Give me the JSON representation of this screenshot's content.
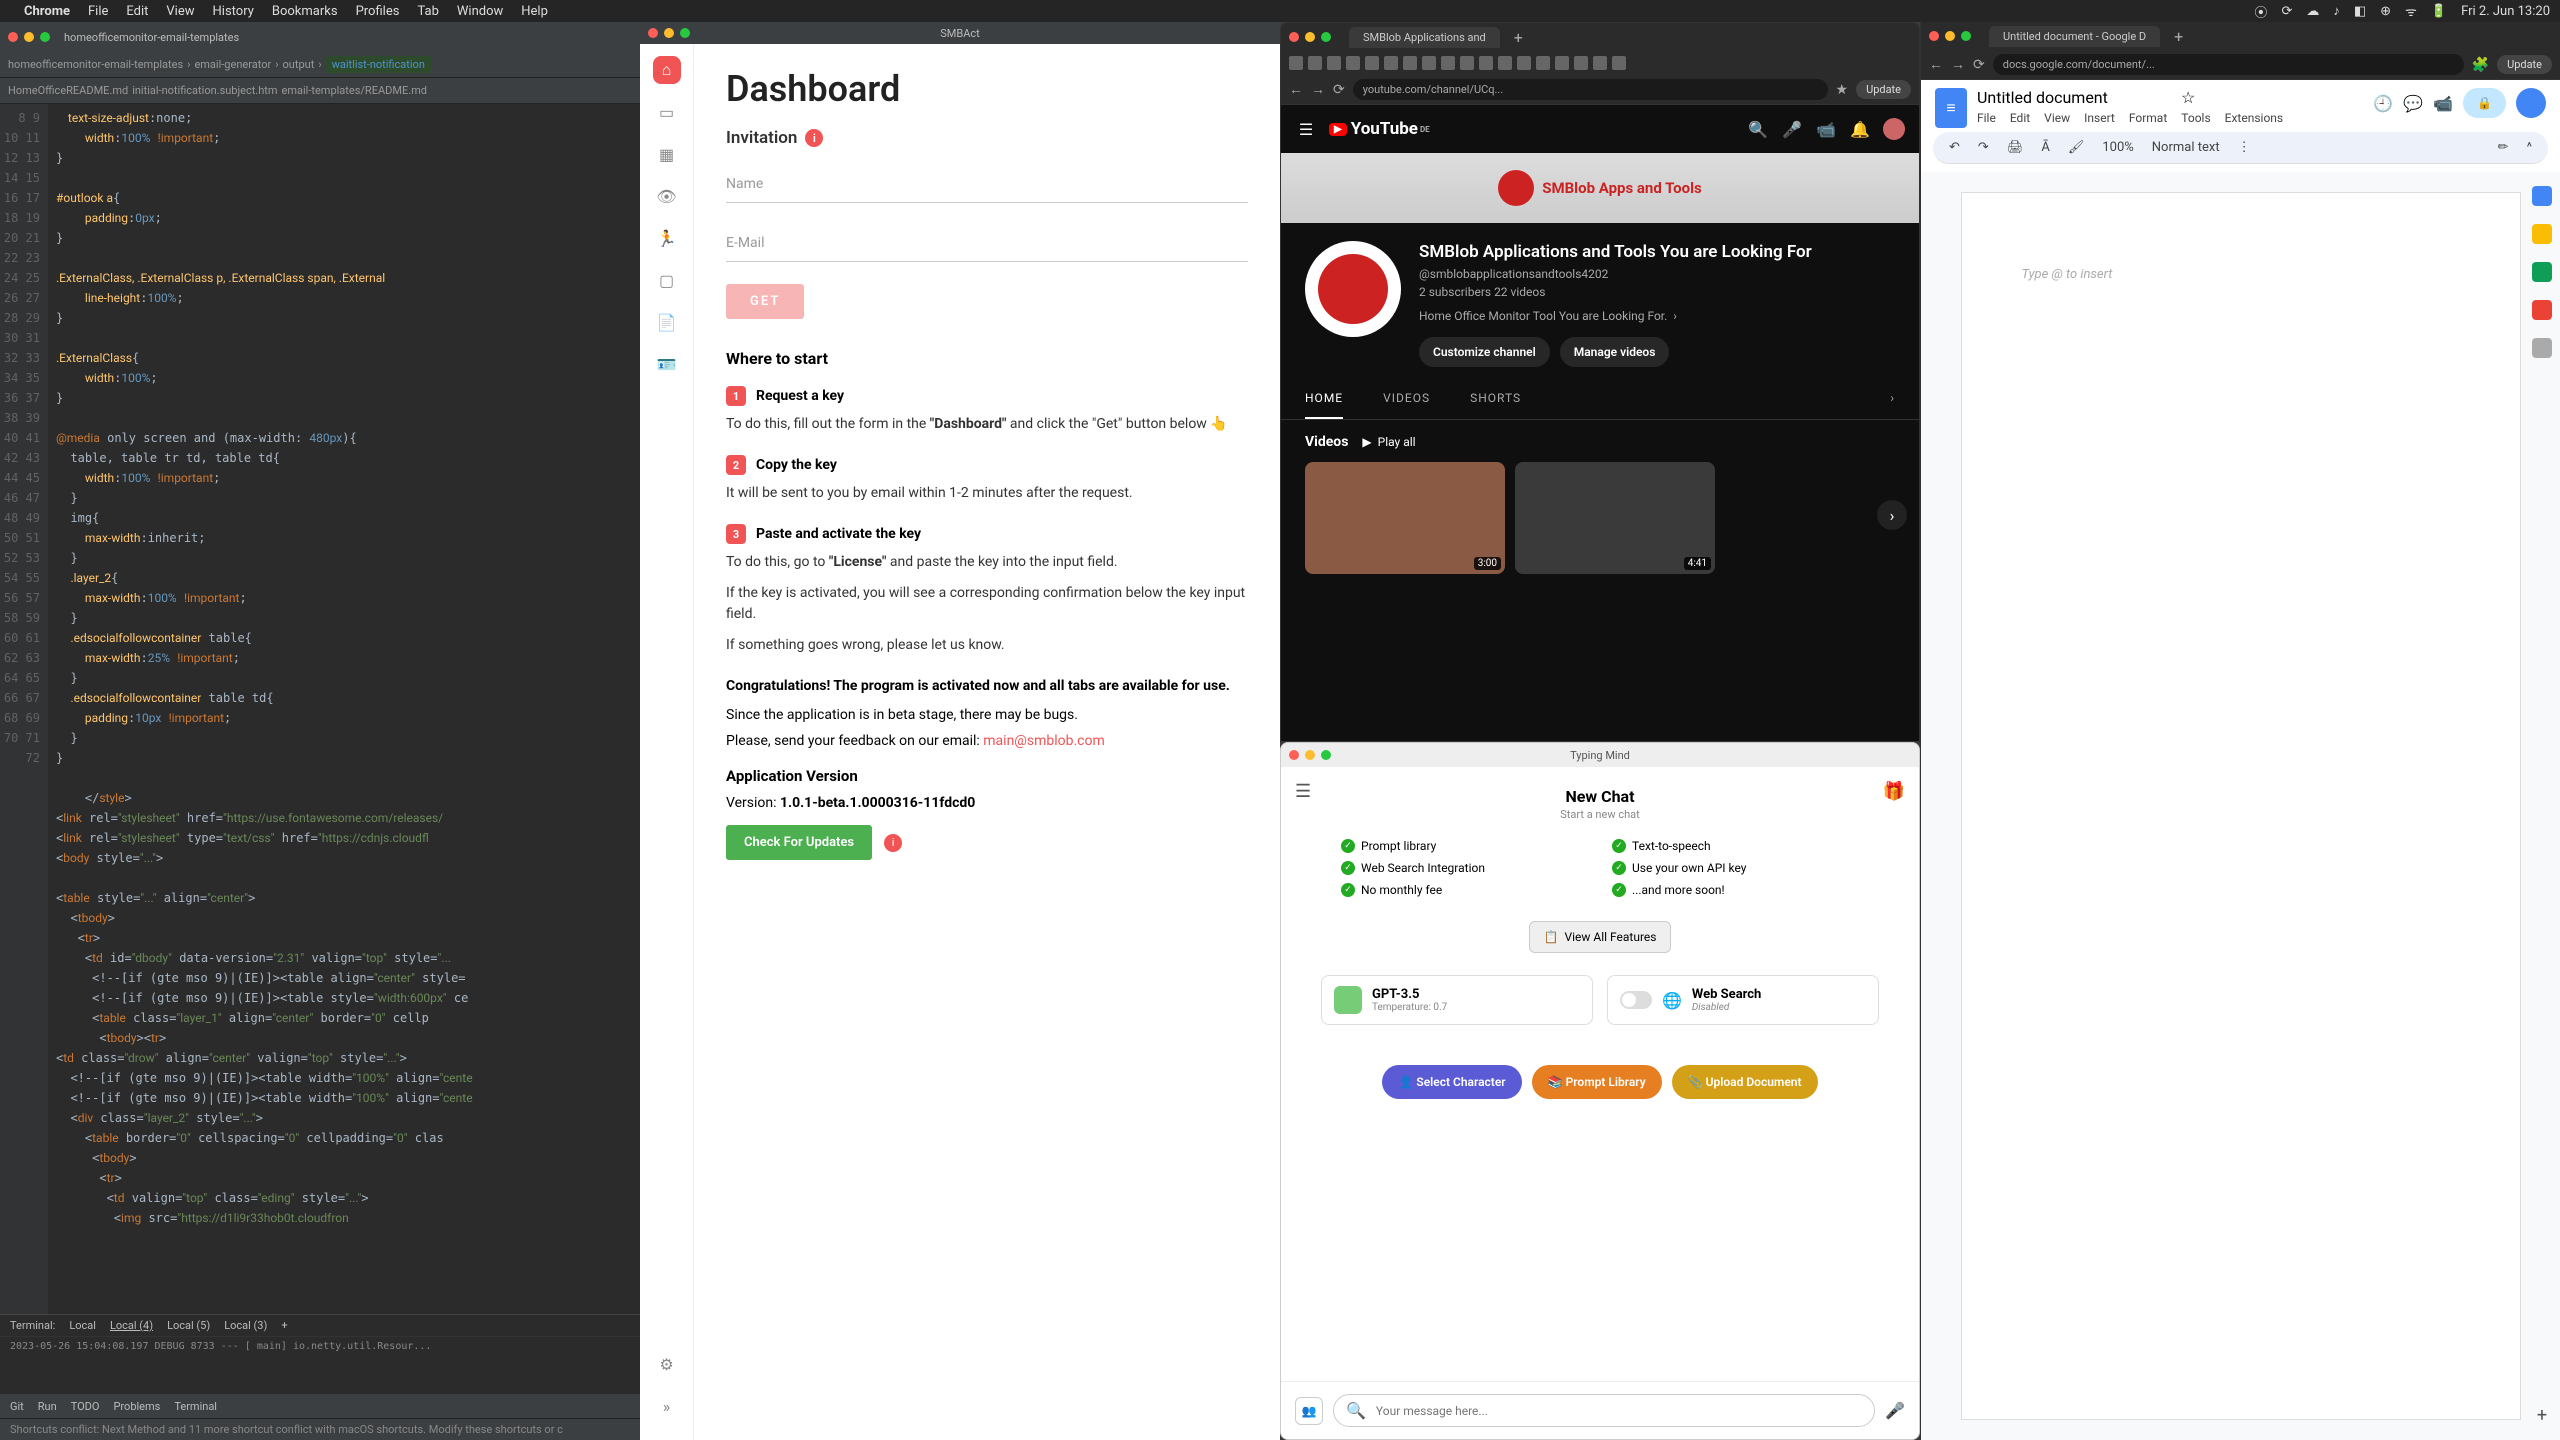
{
  "menubar": {
    "app": "Chrome",
    "items": [
      "File",
      "Edit",
      "View",
      "History",
      "Bookmarks",
      "Profiles",
      "Tab",
      "Window",
      "Help"
    ],
    "clock": "Fri 2. Jun 13:20"
  },
  "ide": {
    "top_tab": "homeofficemonitor-email-templates",
    "breadcrumb": [
      "homeofficemonitor-email-templates",
      "email-generator",
      "output",
      "waitlist-notification"
    ],
    "file_tabs": [
      "HomeOfficeREADME.md",
      "initial-notification.subject.htm",
      "email-templates/README.md"
    ],
    "term_tabs": [
      "Terminal:",
      "Local",
      "Local (4)",
      "Local (5)",
      "Local (3)"
    ],
    "status_items": [
      "Git",
      "Run",
      "TODO",
      "Problems",
      "Terminal"
    ],
    "footer_warn": "Shortcuts conflict: Next Method and 11 more shortcut conflict with macOS shortcuts. Modify these shortcuts or c",
    "line_start": 8
  },
  "smbact_title": "SMBAct",
  "dash": {
    "title": "Dashboard",
    "invitation": "Invitation",
    "name_ph": "Name",
    "email_ph": "E-Mail",
    "get": "GET",
    "where": "Where to start",
    "step1_t": "Request a key",
    "step1_b": "To do this, fill out the form in the \"Dashboard\" and click the \"Get\" button below",
    "step2_t": "Copy the key",
    "step2_b": "It will be sent to you by email within 1-2 minutes after the request.",
    "step3_t": "Paste and activate the key",
    "step3_b1": "To do this, go to \"License\" and paste the key into the input field.",
    "step3_b2": "If the key is activated, you will see a corresponding confirmation below the key input field.",
    "step3_b3": "If something goes wrong, please let us know.",
    "congrats": "Congratulations! The program is activated now and all tabs are available for use.",
    "beta": "Since the application is in beta stage, there may be bugs.",
    "feedback": "Please, send your feedback on our email: ",
    "email": "main@smblob.com",
    "appver_t": "Application Version",
    "appver_l": "Version: ",
    "appver_v": "1.0.1-beta.1.0000316-11fdcd0",
    "check": "Check For Updates"
  },
  "yt": {
    "tab_title": "SMBlob Applications and",
    "url": "youtube.com/channel/UCq...",
    "update": "Update",
    "logo": "YouTube",
    "banner_txt": "SMBlob Apps and Tools",
    "channel": "SMBlob Applications and Tools You are Looking For",
    "handle": "@smblobapplicationsandtools4202",
    "subs": "2 subscribers  22 videos",
    "desc": "Home Office Monitor Tool You are Looking For.",
    "btn_customize": "Customize channel",
    "btn_manage": "Manage videos",
    "tabs": [
      "HOME",
      "VIDEOS",
      "SHORTS"
    ],
    "videos_label": "Videos",
    "play_all": "Play all",
    "dur1": "3:00",
    "dur2": "4:41"
  },
  "tm": {
    "title": "Typing Mind",
    "new_chat": "New Chat",
    "sub": "Start a new chat",
    "features": [
      "Prompt library",
      "Text-to-speech",
      "Web Search Integration",
      "Use your own API key",
      "No monthly fee",
      "...and more soon!"
    ],
    "view_all": "View All Features",
    "gpt": "GPT-3.5",
    "gpt_sub": "Temperature: 0.7",
    "ws": "Web Search",
    "ws_sub": "Disabled",
    "select_char": "Select Character",
    "prompt_lib": "Prompt Library",
    "upload": "Upload Document",
    "input_ph": "Your message here..."
  },
  "gd": {
    "tab_title": "Untitled document - Google D",
    "url": "docs.google.com/document/...",
    "update": "Update",
    "doc_title": "Untitled document",
    "menus": [
      "File",
      "Edit",
      "View",
      "Insert",
      "Format",
      "Tools",
      "Extensions"
    ],
    "zoom": "100%",
    "style": "Normal text",
    "placeholder": "Type @ to insert"
  }
}
